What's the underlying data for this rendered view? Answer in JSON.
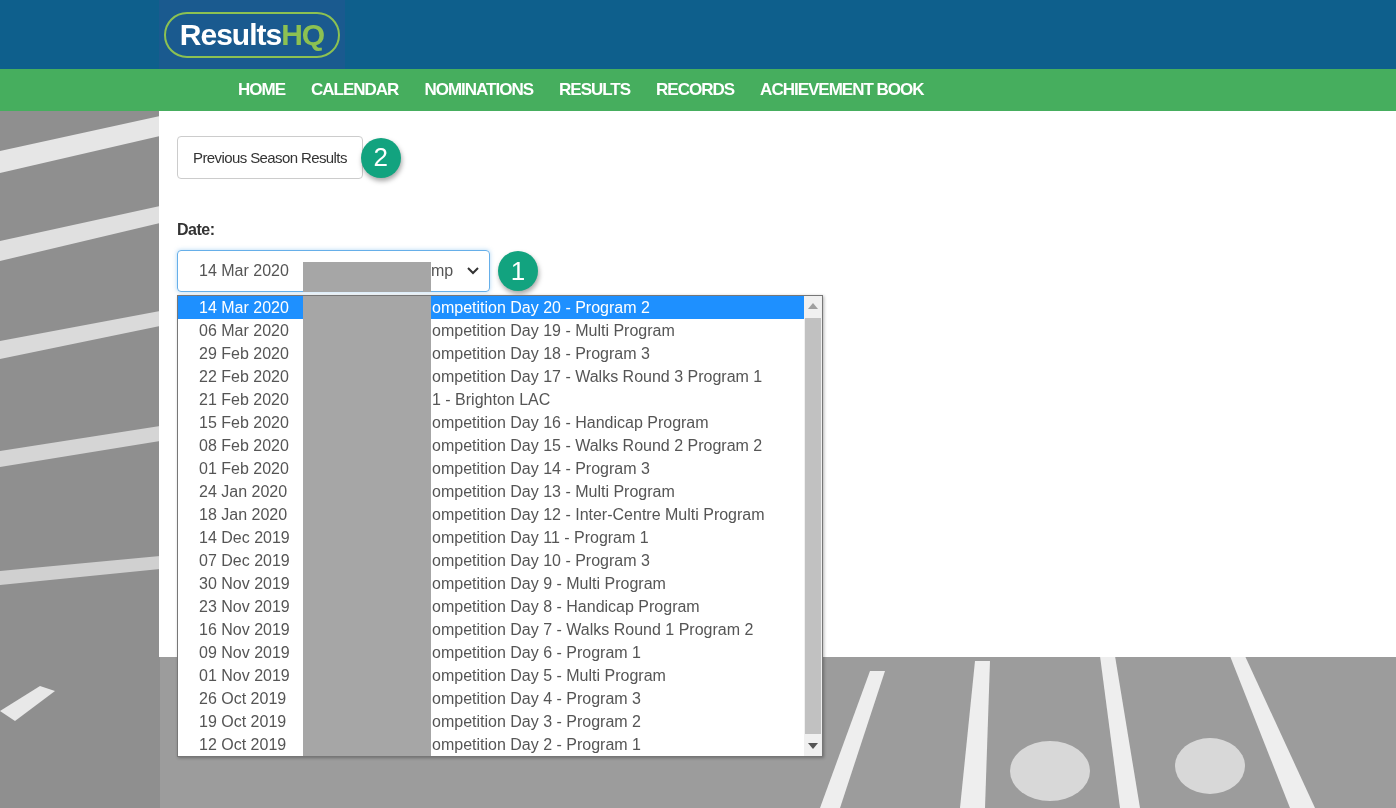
{
  "logo": {
    "text": "Results",
    "accent": "HQ"
  },
  "nav": [
    {
      "label": "HOME"
    },
    {
      "label": "CALENDAR"
    },
    {
      "label": "NOMINATIONS"
    },
    {
      "label": "RESULTS"
    },
    {
      "label": "RECORDS"
    },
    {
      "label": "ACHIEVEMENT BOOK"
    }
  ],
  "previous_button": {
    "label": "Previous Season Results",
    "badge": "2"
  },
  "date_field": {
    "label": "Date:",
    "value_start": "14 Mar 2020",
    "value_end": "mp",
    "badge": "1",
    "options": [
      {
        "date": "14 Mar 2020",
        "detail": "ompetition Day 20 - Program 2",
        "selected": true
      },
      {
        "date": "06 Mar 2020",
        "detail": "ompetition Day 19 - Multi Program",
        "selected": false
      },
      {
        "date": "29 Feb 2020",
        "detail": "ompetition Day 18 - Program 3",
        "selected": false
      },
      {
        "date": "22 Feb 2020",
        "detail": "ompetition Day 17 - Walks Round 3 Program 1",
        "selected": false
      },
      {
        "date": "21 Feb 2020",
        "detail": "1 - Brighton LAC",
        "selected": false
      },
      {
        "date": "15 Feb 2020",
        "detail": "ompetition Day 16 - Handicap Program",
        "selected": false
      },
      {
        "date": "08 Feb 2020",
        "detail": "ompetition Day 15 - Walks Round 2 Program 2",
        "selected": false
      },
      {
        "date": "01 Feb 2020",
        "detail": "ompetition Day 14 - Program 3",
        "selected": false
      },
      {
        "date": "24 Jan 2020",
        "detail": "ompetition Day 13 - Multi Program",
        "selected": false
      },
      {
        "date": "18 Jan 2020",
        "detail": "ompetition Day 12 - Inter-Centre Multi Program",
        "selected": false
      },
      {
        "date": "14 Dec 2019",
        "detail": "ompetition Day 11 - Program 1",
        "selected": false
      },
      {
        "date": "07 Dec 2019",
        "detail": "ompetition Day 10 - Program 3",
        "selected": false
      },
      {
        "date": "30 Nov 2019",
        "detail": "ompetition Day 9 - Multi Program",
        "selected": false
      },
      {
        "date": "23 Nov 2019",
        "detail": "ompetition Day 8 - Handicap Program",
        "selected": false
      },
      {
        "date": "16 Nov 2019",
        "detail": "ompetition Day 7 - Walks Round 1 Program 2",
        "selected": false
      },
      {
        "date": "09 Nov 2019",
        "detail": "ompetition Day 6 - Program 1",
        "selected": false
      },
      {
        "date": "01 Nov 2019",
        "detail": "ompetition Day 5 - Multi Program",
        "selected": false
      },
      {
        "date": "26 Oct 2019",
        "detail": "ompetition Day 4 - Program 3",
        "selected": false
      },
      {
        "date": "19 Oct 2019",
        "detail": "ompetition Day 3 - Program 2",
        "selected": false
      },
      {
        "date": "12 Oct 2019",
        "detail": "ompetition Day 2 - Program 1",
        "selected": false
      }
    ]
  }
}
